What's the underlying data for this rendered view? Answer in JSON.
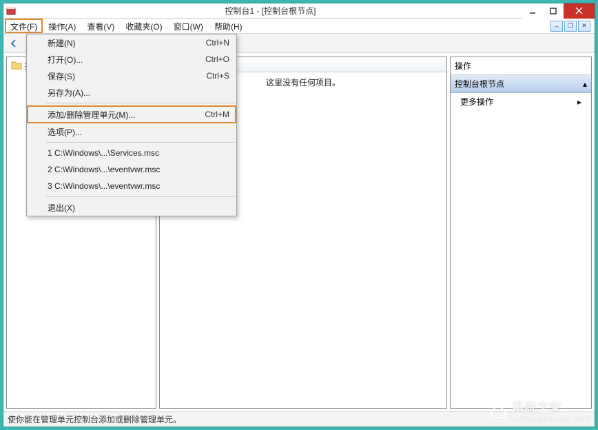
{
  "titlebar": {
    "title": "控制台1 - [控制台根节点]"
  },
  "menubar": {
    "items": [
      {
        "label": "文件(F)"
      },
      {
        "label": "操作(A)"
      },
      {
        "label": "查看(V)"
      },
      {
        "label": "收藏夹(O)"
      },
      {
        "label": "窗口(W)"
      },
      {
        "label": "帮助(H)"
      }
    ]
  },
  "file_menu": {
    "items": [
      {
        "label": "新建(N)",
        "shortcut": "Ctrl+N"
      },
      {
        "label": "打开(O)...",
        "shortcut": "Ctrl+O"
      },
      {
        "label": "保存(S)",
        "shortcut": "Ctrl+S"
      },
      {
        "label": "另存为(A)...",
        "shortcut": ""
      }
    ],
    "snapin": {
      "label": "添加/删除管理单元(M)...",
      "shortcut": "Ctrl+M"
    },
    "options": {
      "label": "选项(P)..."
    },
    "recent": [
      {
        "label": "1 C:\\Windows\\...\\Services.msc"
      },
      {
        "label": "2 C:\\Windows\\...\\eventvwr.msc"
      },
      {
        "label": "3 C:\\Windows\\...\\eventvwr.msc"
      }
    ],
    "exit": {
      "label": "退出(X)"
    }
  },
  "tree": {
    "root_label": "控制台根节点"
  },
  "middle": {
    "empty_text": "这里没有任何项目。"
  },
  "actions": {
    "pane_title": "操作",
    "header": "控制台根节点",
    "more": "更多操作"
  },
  "statusbar": {
    "text": "使你能在管理单元控制台添加或删除管理单元。"
  },
  "watermark": {
    "main": "系统之家",
    "sub": "XITONGZHIJIA.NET"
  }
}
